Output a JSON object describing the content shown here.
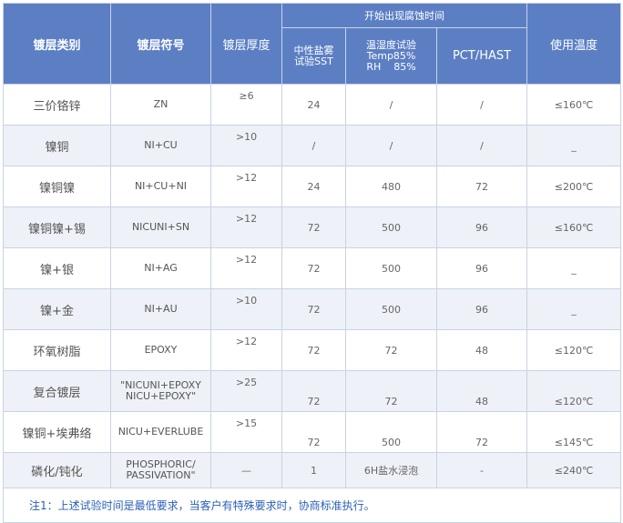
{
  "table": {
    "group_header": "开始出现腐蚀时间",
    "col_category": "镀层类别",
    "col_symbol": "镀层符号",
    "col_thickness": "镀层厚度",
    "sub_sst": [
      "中性盐雾",
      "试验SST"
    ],
    "sub_humid": [
      "温湿度试验",
      "Temp85%",
      "RH    85%"
    ],
    "sub_pct": "PCT/HAST",
    "col_temp": "使用温度",
    "rows": [
      {
        "category": "三价铬锌",
        "symbol": [
          "ZN"
        ],
        "thickness": "≥6",
        "sst": "24",
        "humid": "/",
        "pct": "/",
        "temp": "≤160℃"
      },
      {
        "category": "镍铜",
        "symbol": [
          "NI+CU"
        ],
        "thickness": ">10",
        "sst": "/",
        "humid": "/",
        "pct": "/",
        "temp": "_"
      },
      {
        "category": "镍铜镍",
        "symbol": [
          "NI+CU+NI"
        ],
        "thickness": ">12",
        "sst": "24",
        "humid": "480",
        "pct": "72",
        "temp": "≤200℃"
      },
      {
        "category": "镍铜镍+锡",
        "symbol": [
          "NICUNI+SN"
        ],
        "thickness": ">12",
        "sst": "72",
        "humid": "500",
        "pct": "96",
        "temp": "≤160℃"
      },
      {
        "category": "镍+银",
        "symbol": [
          "NI+AG"
        ],
        "thickness": ">12",
        "sst": "72",
        "humid": "500",
        "pct": "96",
        "temp": "_"
      },
      {
        "category": "镍+金",
        "symbol": [
          "NI+AU"
        ],
        "thickness": ">10",
        "sst": "72",
        "humid": "500",
        "pct": "96",
        "temp": "_"
      },
      {
        "category": "环氧树脂",
        "symbol": [
          "EPOXY"
        ],
        "thickness": ">12",
        "sst": "72",
        "humid": "72",
        "pct": "48",
        "temp": "≤120℃"
      },
      {
        "category": "复合镀层",
        "symbol": [
          "\"NICUNI+EPOXY",
          "NICU+EPOXY\""
        ],
        "thickness": ">25",
        "sst": "72",
        "humid": "72",
        "pct": "48",
        "temp": "≤120℃"
      },
      {
        "category": "镍铜+埃弗络",
        "symbol": [
          "NICU+EVERLUBE"
        ],
        "thickness": ">15",
        "sst": "72",
        "humid": "500",
        "pct": "72",
        "temp": "≤145℃"
      },
      {
        "category": "磷化/钝化",
        "symbol": [
          "PHOSPHORIC/",
          "PASSIVATION\""
        ],
        "thickness": "—",
        "sst": "1",
        "humid": "6H盐水浸泡",
        "pct": "-",
        "temp": "≤240℃"
      }
    ],
    "note": "注1：上述试验时间是最低要求，当客户有特殊要求时，协商标准执行。"
  }
}
